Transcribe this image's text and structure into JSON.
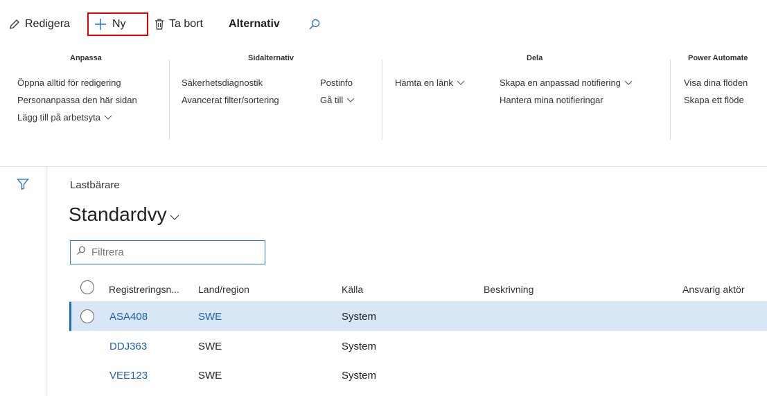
{
  "toolbar": {
    "edit_label": "Redigera",
    "new_label": "Ny",
    "delete_label": "Ta bort",
    "active_tab": "Alternativ"
  },
  "ribbon": {
    "groups": [
      {
        "title": "Anpassa",
        "items": [
          "Öppna alltid för redigering",
          "Personanpassa den här sidan",
          "Lägg till på arbetsyta"
        ]
      },
      {
        "title": "Sidalternativ",
        "items": [
          "Säkerhetsdiagnostik",
          "Avancerat filter/sortering",
          "Postinfo",
          "Gå till"
        ]
      },
      {
        "title": "Dela",
        "items": [
          "Hämta en länk",
          "Skapa en anpassad notifiering",
          "Hantera mina notifieringar"
        ]
      },
      {
        "title": "Power Automate",
        "items": [
          "Visa dina flöden",
          "Skapa ett flöde"
        ]
      }
    ]
  },
  "page": {
    "breadcrumb": "Lastbärare",
    "view_name": "Standardvy",
    "filter_placeholder": "Filtrera"
  },
  "grid": {
    "columns": [
      "Registreringsn...",
      "Land/region",
      "Källa",
      "Beskrivning",
      "Ansvarig aktör"
    ],
    "rows": [
      {
        "reg": "ASA408",
        "country": "SWE",
        "source": "System",
        "selected": true
      },
      {
        "reg": "DDJ363",
        "country": "SWE",
        "source": "System",
        "selected": false
      },
      {
        "reg": "VEE123",
        "country": "SWE",
        "source": "System",
        "selected": false
      }
    ]
  },
  "colors": {
    "accent": "#1b6ec2",
    "highlight_border": "#e00000",
    "selected_row": "#d9e6f6"
  }
}
